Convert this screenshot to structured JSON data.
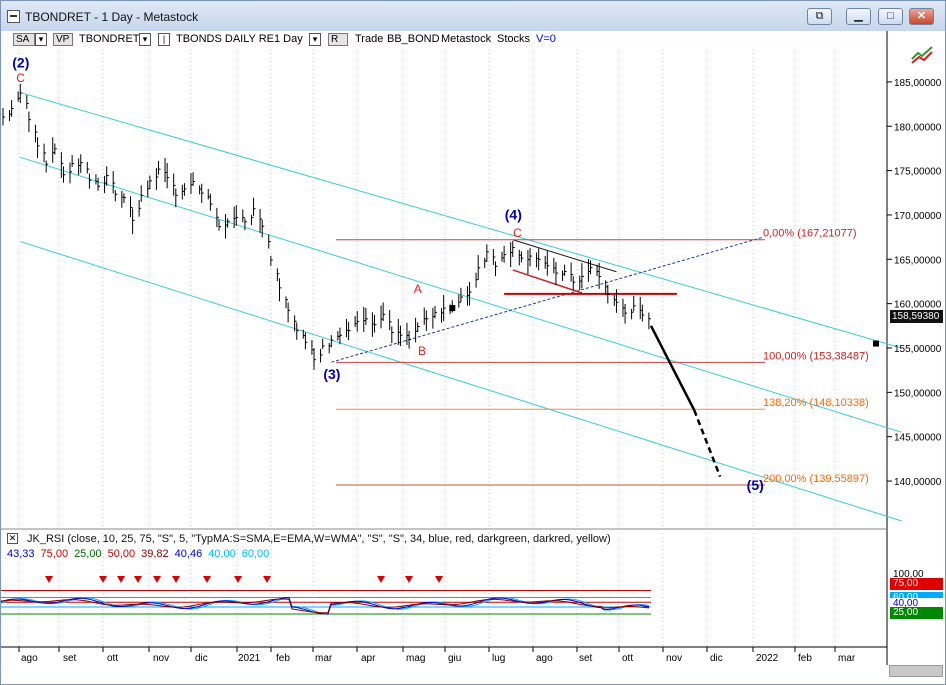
{
  "window": {
    "title": "TBONDRET - 1 Day - Metastock",
    "restore_glyph": "⧉",
    "minimize_glyph": "▁",
    "maximize_glyph": "□",
    "close_glyph": "✕"
  },
  "toolbar": {
    "sa": "SA",
    "vp": "VP",
    "symbol": "TBONDRET",
    "name": "TBONDS DAILY RE",
    "period": "1 Day",
    "r_btn": "R",
    "trade": "Trade",
    "bb_bond": "BB_BOND",
    "source": "Metastock",
    "stocks": "Stocks",
    "v_value": "V=0",
    "dropdown_glyph": "▾",
    "pin_glyph": "|"
  },
  "colors": {
    "price_bars": "#000000",
    "channel": "#33ccdd",
    "fib": "#cc2222",
    "fib_label": "#ff6600",
    "wave_label": "#0000aa",
    "rsi_blue": "#0000cc",
    "rsi_cyan": "#00aaff"
  },
  "chart_data": {
    "type": "line",
    "title": "TBONDRET - 1 Day",
    "x_labels": [
      "ago",
      "set",
      "ott",
      "nov",
      "dic",
      "2021",
      "feb",
      "mar",
      "apr",
      "mag",
      "giu",
      "lug",
      "ago",
      "set",
      "ott",
      "nov",
      "dic",
      "2022",
      "feb",
      "mar"
    ],
    "y_ticks": [
      "185,00000",
      "180,00000",
      "175,00000",
      "170,00000",
      "165,00000",
      "160,00000",
      "155,00000",
      "150,00000",
      "145,00000",
      "140,00000"
    ],
    "ylim": [
      136,
      188
    ],
    "last_price": "158,59380",
    "series": [
      {
        "kind": "ohlc",
        "values": [
          [
            0,
            181
          ],
          [
            2,
            182
          ],
          [
            4,
            183.8
          ],
          [
            6,
            181
          ],
          [
            8,
            178
          ],
          [
            10,
            176
          ],
          [
            12,
            177.5
          ],
          [
            14,
            174.5
          ],
          [
            16,
            175.5
          ],
          [
            18,
            176
          ],
          [
            20,
            174
          ],
          [
            22,
            173
          ],
          [
            24,
            174.5
          ],
          [
            26,
            172.5
          ],
          [
            28,
            172
          ],
          [
            30,
            169.5
          ],
          [
            32,
            172
          ],
          [
            34,
            174
          ],
          [
            36,
            175
          ],
          [
            38,
            174
          ],
          [
            40,
            172.5
          ],
          [
            42,
            173
          ],
          [
            44,
            173.5
          ],
          [
            46,
            172.5
          ],
          [
            48,
            171
          ],
          [
            50,
            168.5
          ],
          [
            52,
            169.5
          ],
          [
            54,
            169.5
          ],
          [
            56,
            169.5
          ],
          [
            58,
            170.5
          ],
          [
            60,
            169
          ],
          [
            62,
            165
          ],
          [
            64,
            162
          ],
          [
            66,
            159.5
          ],
          [
            68,
            157
          ],
          [
            70,
            155.5
          ],
          [
            72,
            153.6
          ],
          [
            74,
            155
          ],
          [
            76,
            156
          ],
          [
            78,
            156.5
          ],
          [
            80,
            157
          ],
          [
            82,
            158
          ],
          [
            84,
            158
          ],
          [
            86,
            157.5
          ],
          [
            88,
            158.5
          ],
          [
            90,
            157
          ],
          [
            92,
            156.5
          ],
          [
            94,
            156
          ],
          [
            96,
            157.5
          ],
          [
            98,
            158.5
          ],
          [
            100,
            159
          ],
          [
            102,
            159.5
          ],
          [
            104,
            159.5
          ],
          [
            106,
            160.5
          ],
          [
            108,
            161.5
          ],
          [
            110,
            164
          ],
          [
            112,
            166
          ],
          [
            114,
            164.5
          ],
          [
            116,
            165.5
          ],
          [
            118,
            166.5
          ],
          [
            120,
            165
          ],
          [
            122,
            165.5
          ],
          [
            124,
            165
          ],
          [
            126,
            164
          ],
          [
            128,
            163.5
          ],
          [
            130,
            163.5
          ],
          [
            132,
            162.5
          ],
          [
            134,
            163
          ],
          [
            136,
            164
          ],
          [
            138,
            163
          ],
          [
            140,
            161
          ],
          [
            142,
            160
          ],
          [
            144,
            159
          ],
          [
            146,
            159.5
          ],
          [
            148,
            158.5
          ],
          [
            150,
            158.6
          ]
        ]
      },
      {
        "kind": "projection",
        "values": [
          [
            150,
            157.5
          ],
          [
            160,
            148
          ],
          [
            166,
            140.5
          ],
          [
            170,
            138.5
          ]
        ]
      }
    ],
    "channels": [
      {
        "from": [
          4,
          183.8
        ],
        "to": [
          208,
          155
        ]
      },
      {
        "from": [
          4,
          176.5
        ],
        "to": [
          208,
          145.5
        ]
      },
      {
        "from": [
          4,
          167
        ],
        "to": [
          208,
          135.5
        ]
      }
    ],
    "annotations": {
      "waves": [
        {
          "label": "(2)",
          "at": [
            4,
            186.6
          ]
        },
        {
          "label": "(3)",
          "at": [
            76,
            151.5
          ]
        },
        {
          "label": "(4)",
          "at": [
            118,
            169.5
          ]
        },
        {
          "label": "(5)",
          "at": [
            174,
            139
          ]
        }
      ],
      "subwaves": [
        {
          "label": "C",
          "at": [
            4,
            185
          ]
        },
        {
          "label": "A",
          "at": [
            96,
            161.2
          ]
        },
        {
          "label": "B",
          "at": [
            97,
            154.2
          ]
        },
        {
          "label": "C",
          "at": [
            119,
            167.5
          ]
        }
      ],
      "fib_levels": [
        {
          "label": "0,00% (167,21077)",
          "value": 167.21
        },
        {
          "label": "100,00% (153,38487)",
          "value": 153.38
        },
        {
          "label": "138,20% (148,10338)",
          "value": 148.1
        },
        {
          "label": "200,00% (139,55897)",
          "value": 139.56
        }
      ]
    }
  },
  "indicator": {
    "close_glyph": "✕",
    "title": "JK_RSI   (close,  10,  25,  75,  \"S\",  5,  \"TypMA:S=SMA,E=EMA,W=WMA\",  \"S\",  \"S\",  34,  blue,  red,  darkgreen,  darkred,  yellow)",
    "values": [
      {
        "text": "43,33",
        "color": "#0000cc"
      },
      {
        "text": "75,00",
        "color": "#cc0000"
      },
      {
        "text": "25,00",
        "color": "#006600"
      },
      {
        "text": "50,00",
        "color": "#cc0000"
      },
      {
        "text": "39,82",
        "color": "#880000"
      },
      {
        "text": "40,46",
        "color": "#0000cc"
      },
      {
        "text": "40,00",
        "color": "#00bbff"
      },
      {
        "text": "60,00",
        "color": "#00bbff"
      }
    ],
    "scale_labels": [
      {
        "text": "100,00",
        "bg": "#ffffff",
        "fg": "#000000"
      },
      {
        "text": "75,00",
        "bg": "#dd0000",
        "fg": "#ffffff"
      },
      {
        "text": "60,00",
        "bg": "#00aaff",
        "fg": "#ffffff"
      },
      {
        "text": "40,00",
        "bg": "#ffffff",
        "fg": "#0000cc"
      },
      {
        "text": "25,00",
        "bg": "#008800",
        "fg": "#ffffff"
      }
    ]
  }
}
